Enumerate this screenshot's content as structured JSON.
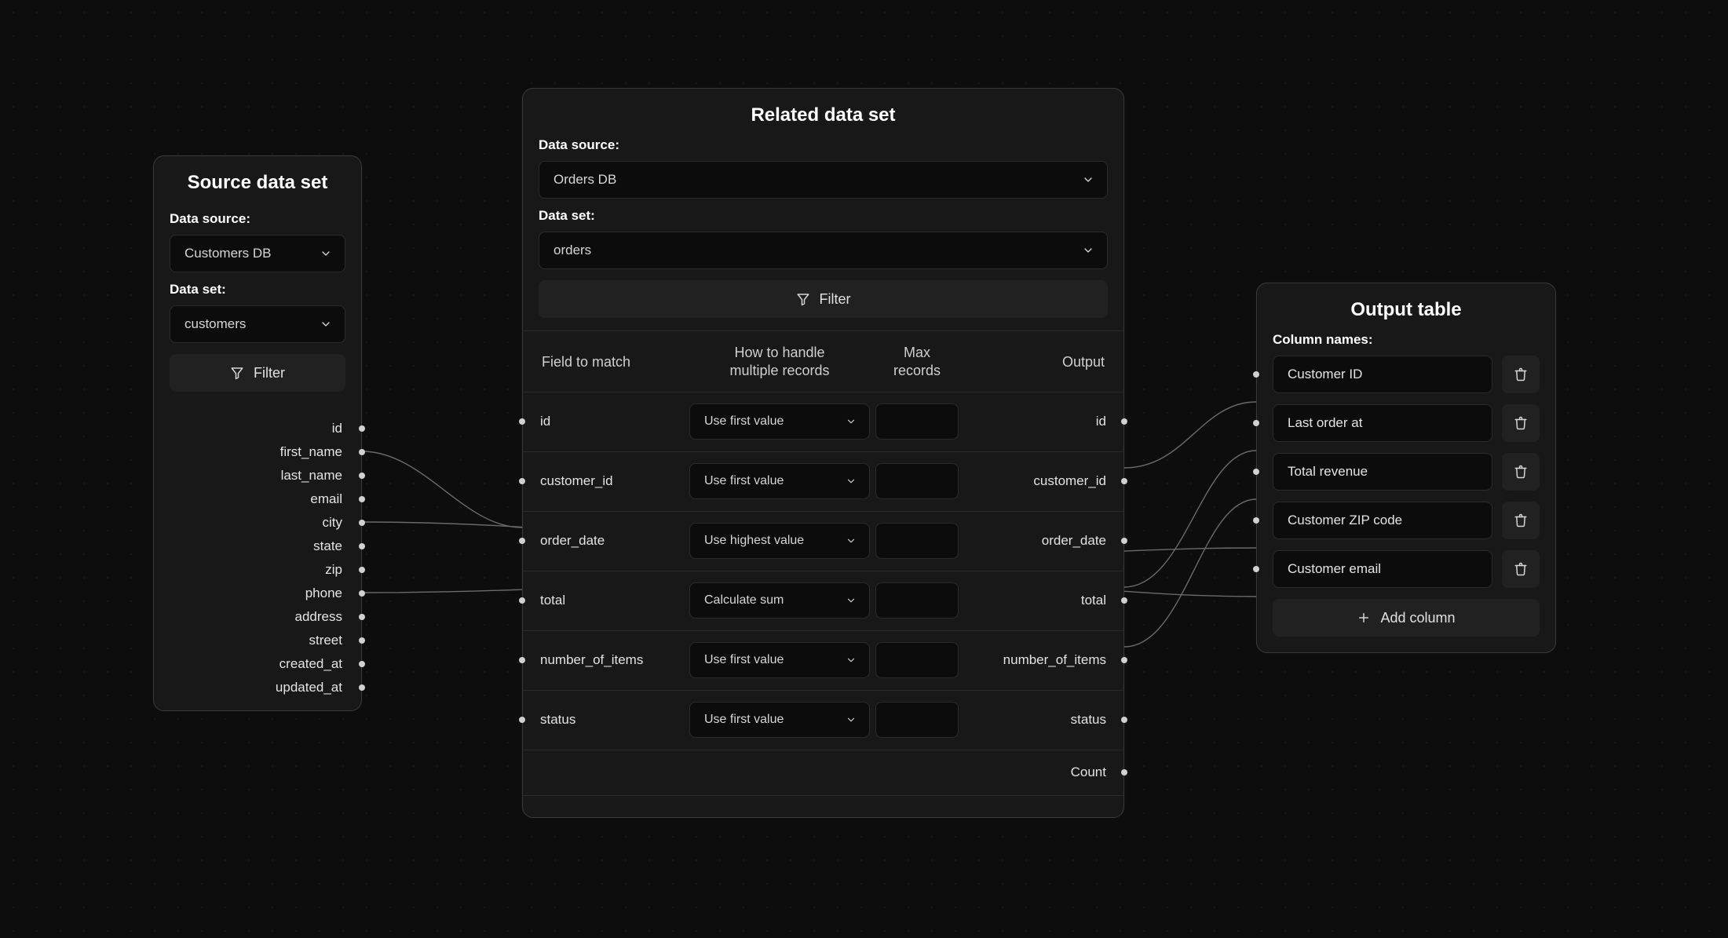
{
  "source_node": {
    "title": "Source data set",
    "data_source_label": "Data source:",
    "data_source_value": "Customers DB",
    "data_set_label": "Data set:",
    "data_set_value": "customers",
    "filter_label": "Filter",
    "fields": [
      "id",
      "first_name",
      "last_name",
      "email",
      "city",
      "state",
      "zip",
      "phone",
      "address",
      "street",
      "created_at",
      "updated_at"
    ]
  },
  "related_node": {
    "title": "Related data set",
    "data_source_label": "Data source:",
    "data_source_value": "Orders DB",
    "data_set_label": "Data set:",
    "data_set_value": "orders",
    "filter_label": "Filter",
    "col_field": "Field to match",
    "col_handle_l1": "How to handle",
    "col_handle_l2": "multiple records",
    "col_max_l1": "Max",
    "col_max_l2": "records",
    "col_output": "Output",
    "rows": [
      {
        "field": "id",
        "handle": "Use first value",
        "output": "id"
      },
      {
        "field": "customer_id",
        "handle": "Use first value",
        "output": "customer_id"
      },
      {
        "field": "order_date",
        "handle": "Use highest value",
        "output": "order_date"
      },
      {
        "field": "total",
        "handle": "Calculate sum",
        "output": "total"
      },
      {
        "field": "number_of_items",
        "handle": "Use first value",
        "output": "number_of_items"
      },
      {
        "field": "status",
        "handle": "Use first value",
        "output": "status"
      }
    ],
    "count_label": "Count"
  },
  "output_node": {
    "title": "Output table",
    "column_names_label": "Column names:",
    "columns": [
      "Customer ID",
      "Last order at",
      "Total revenue",
      "Customer ZIP code",
      "Customer email"
    ],
    "add_column_label": "Add column"
  }
}
